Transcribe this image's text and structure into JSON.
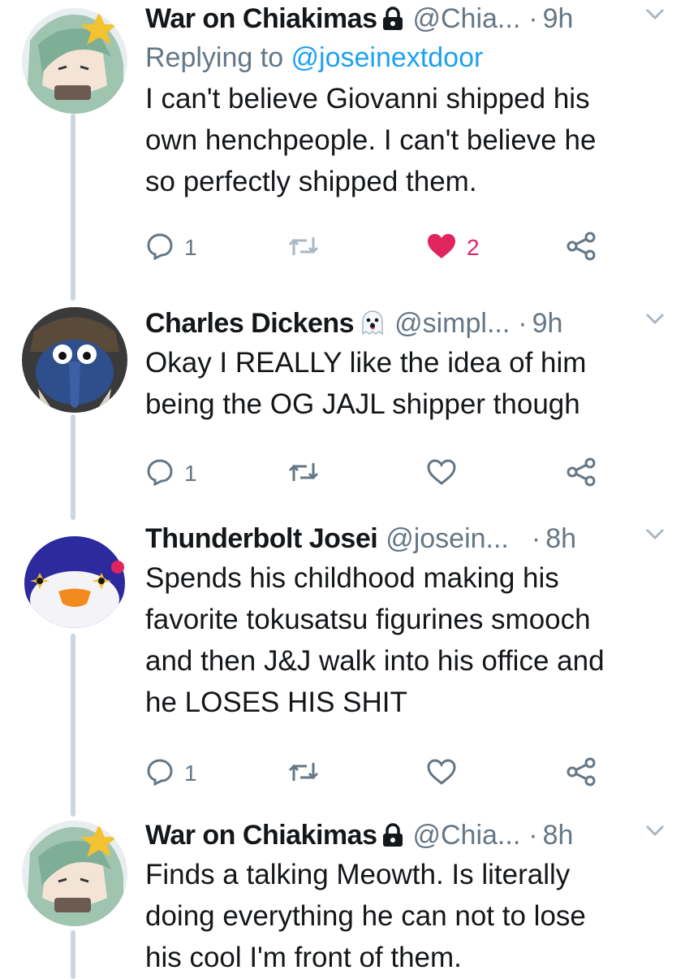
{
  "tweets": [
    {
      "name": "War on Chiakimas",
      "badge": "lock-icon",
      "handle": "@Chia...",
      "separator": "·",
      "time": "9h",
      "reply_prefix": "Replying to ",
      "reply_handle": "@joseinextdoor",
      "text": [
        "I can't believe Giovanni shipped his",
        "own henchpeople. I can't believe he",
        "so perfectly shipped them."
      ],
      "reply_count": "1",
      "retweet_count": "",
      "like_count": "2",
      "liked": true
    },
    {
      "name": "Charles Dickens",
      "badge": "ghost-emoji-icon",
      "handle": "@simpl...",
      "separator": "·",
      "time": "9h",
      "text": [
        "Okay I REALLY like the idea of him",
        "being the OG JAJL shipper though"
      ],
      "reply_count": "1",
      "retweet_count": "",
      "like_count": "",
      "liked": false
    },
    {
      "name": "Thunderbolt Josei",
      "handle": "@josein...",
      "separator": "·",
      "time": "8h",
      "text": [
        "Spends his childhood making his",
        "favorite tokusatsu figurines smooch",
        "and then J&J walk into his office and",
        "he LOSES HIS SHIT"
      ],
      "reply_count": "1",
      "retweet_count": "",
      "like_count": "",
      "liked": false
    },
    {
      "name": "War on Chiakimas",
      "badge": "lock-icon",
      "handle": "@Chia...",
      "separator": "·",
      "time": "8h",
      "text": [
        "Finds a talking Meowth. Is literally",
        "doing everything he can not to lose",
        "his cool I'm front of them."
      ]
    }
  ],
  "colors": {
    "name": "#14171a",
    "meta": "#657786",
    "link": "#1da1f2",
    "like": "#e0245e",
    "thread_line": "#ccd6dd"
  }
}
